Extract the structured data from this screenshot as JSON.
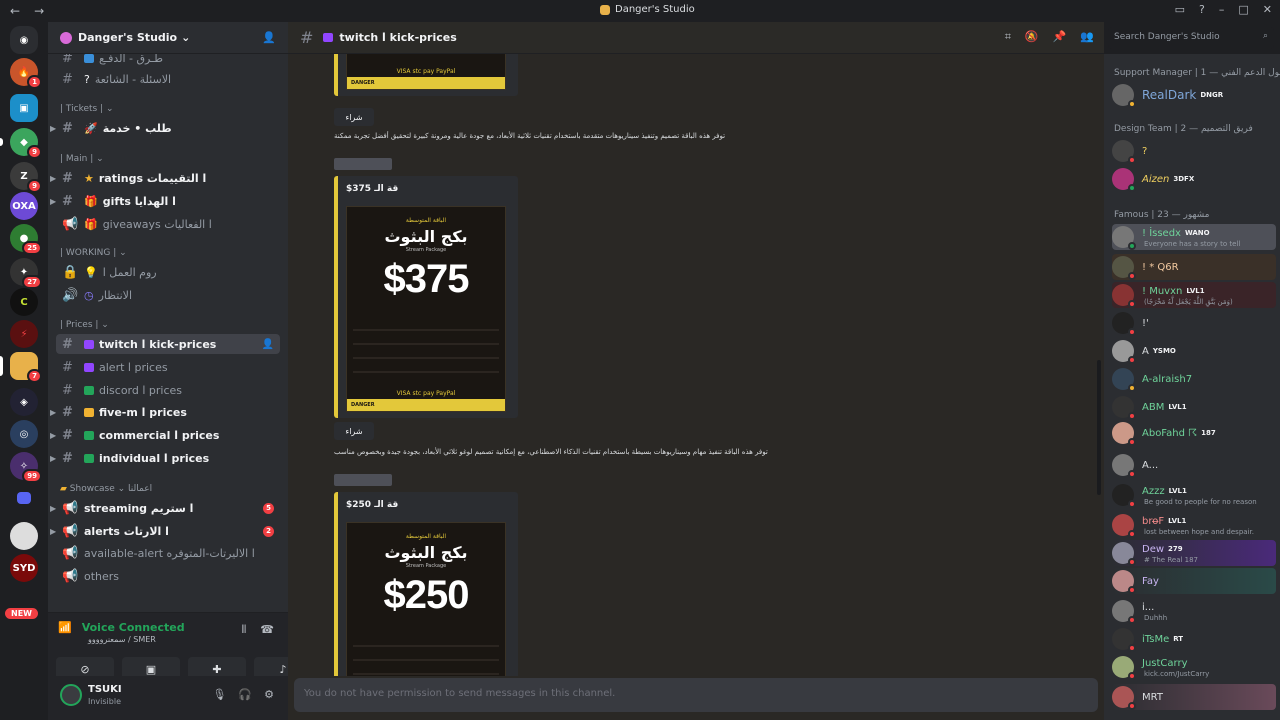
{
  "window": {
    "title": "Danger's Studio"
  },
  "server": {
    "name": "Danger's Studio"
  },
  "channels": [
    {
      "label": "طرق - الدفع",
      "top": 0
    },
    {
      "label": "؟ ا الاسئلة - الشائعة",
      "top": 0
    },
    {
      "label": "طلب • خدمة ا",
      "top": 0
    }
  ],
  "categories": {
    "tickets": "| Tickets |",
    "main": "| Main |",
    "working": "| WORKING |",
    "prices": "| Prices |",
    "showcase": "Showcase ⌄ اعمالنا"
  },
  "channel_labels": {
    "pay": "طـرق - الدفـع",
    "faq": "الاسئلة - الشائعة",
    "order": "طلب • خدمة",
    "ratings": "ratings ا التقييمات",
    "gifts": "gifts ا الهدايا",
    "giveaways": "giveaways ا الفعاليات",
    "room": "روم العمل ا",
    "waiting": "الانتظار",
    "twitch": "twitch ا kick-prices",
    "alert": "alert ا prices",
    "discord": "discord ا prices",
    "fivem": "five-m ا prices",
    "commercial": "commercial ا prices",
    "individual": "individual ا prices",
    "streaming": "streaming ا ستريم",
    "alerts": "alerts ا الارتات",
    "available": "available-alert ا الاليرتات-المتوفره",
    "others": "others"
  },
  "badges": {
    "streaming": "5",
    "alerts": "2"
  },
  "guild_badges": [
    "1",
    "9",
    "9",
    "25",
    "27",
    "7",
    "99"
  ],
  "new_label": "NEW",
  "voice": {
    "status": "Voice Connected",
    "sub": "سمعنروووو / SMER"
  },
  "user": {
    "name": "TSUKI",
    "status": "Invisible"
  },
  "header": {
    "channel": "twitch ا kick-prices"
  },
  "search": {
    "placeholder": "Search Danger's Studio"
  },
  "messages": {
    "buy": "شراء",
    "desc1": "توفر هذه الباقة تصميم وتنفيذ سيناريوهات متقدمة باستخدام تقنيات ثلاثية الأبعاد، مع جودة عالية ومرونة كبيرة لتحقيق أفضل تجربة ممكنة",
    "desc2": "توفر هذه الباقة تنفيذ مهام وسيناريوهات بسيطة باستخدام تقنيات الذكاء الاصطناعي، مع إمكانية تصميم لوغو ثلاثي الأبعاد، بجودة جيدة وبخصوص مناسب",
    "embed2_title": "$375 قة الـ",
    "embed3_title": "$250 قة الـ",
    "poster_pkg": "الباقة المتوسطة",
    "poster_title": "بكج البثوث",
    "poster_sub": "Stream Package",
    "price2": "$375",
    "price3": "$250",
    "poster_pay": "VISA stc pay PayPal",
    "poster_foot": "DANGER"
  },
  "composer": {
    "placeholder": "You do not have permission to send messages in this channel."
  },
  "members": {
    "cat_support": "Support Manager | سول الدعم الفني — 1",
    "cat_design": "Design Team | فريق التصميم — 2",
    "cat_famous": "Famous | مشهور — 23",
    "list": [
      {
        "name": "RealDark",
        "tag": "DNGR",
        "sub": ""
      },
      {
        "name": "?",
        "tag": "",
        "sub": ""
      },
      {
        "name": "Aizen",
        "tag": "3DFX",
        "sub": ""
      },
      {
        "name": "! İssedx",
        "tag": "WANO",
        "sub": "Everyone has a story to tell"
      },
      {
        "name": "! * Q6R",
        "tag": "",
        "sub": ""
      },
      {
        "name": "! Muvxn",
        "tag": "LVL1",
        "sub": "(وَمَن يَتَّقِ اللَّهَ يَجْعَل لَّهُ مَخْرَجًا)"
      },
      {
        "name": "!'",
        "tag": "",
        "sub": ""
      },
      {
        "name": "A",
        "tag": "YSMO",
        "sub": ""
      },
      {
        "name": "A-alraish7",
        "tag": "",
        "sub": ""
      },
      {
        "name": "ABM",
        "tag": "LVL1",
        "sub": ""
      },
      {
        "name": "AboFahd ☈",
        "tag": "187",
        "sub": ""
      },
      {
        "name": "A...",
        "tag": "",
        "sub": ""
      },
      {
        "name": "Azzz",
        "tag": "LVL1",
        "sub": "Be good to people for no reason"
      },
      {
        "name": "bro̶F",
        "tag": "LVL1",
        "sub": "lost between hope and despair."
      },
      {
        "name": "Dew",
        "tag": "279",
        "sub": "# The Real 187"
      },
      {
        "name": "Fay",
        "tag": "",
        "sub": ""
      },
      {
        "name": "i...",
        "tag": "",
        "sub": "Duhhh"
      },
      {
        "name": "iTsMe",
        "tag": "RT",
        "sub": ""
      },
      {
        "name": "JustCarry",
        "tag": "",
        "sub": "kick.com/JustCarry"
      },
      {
        "name": "MRT",
        "tag": "",
        "sub": ""
      }
    ]
  }
}
